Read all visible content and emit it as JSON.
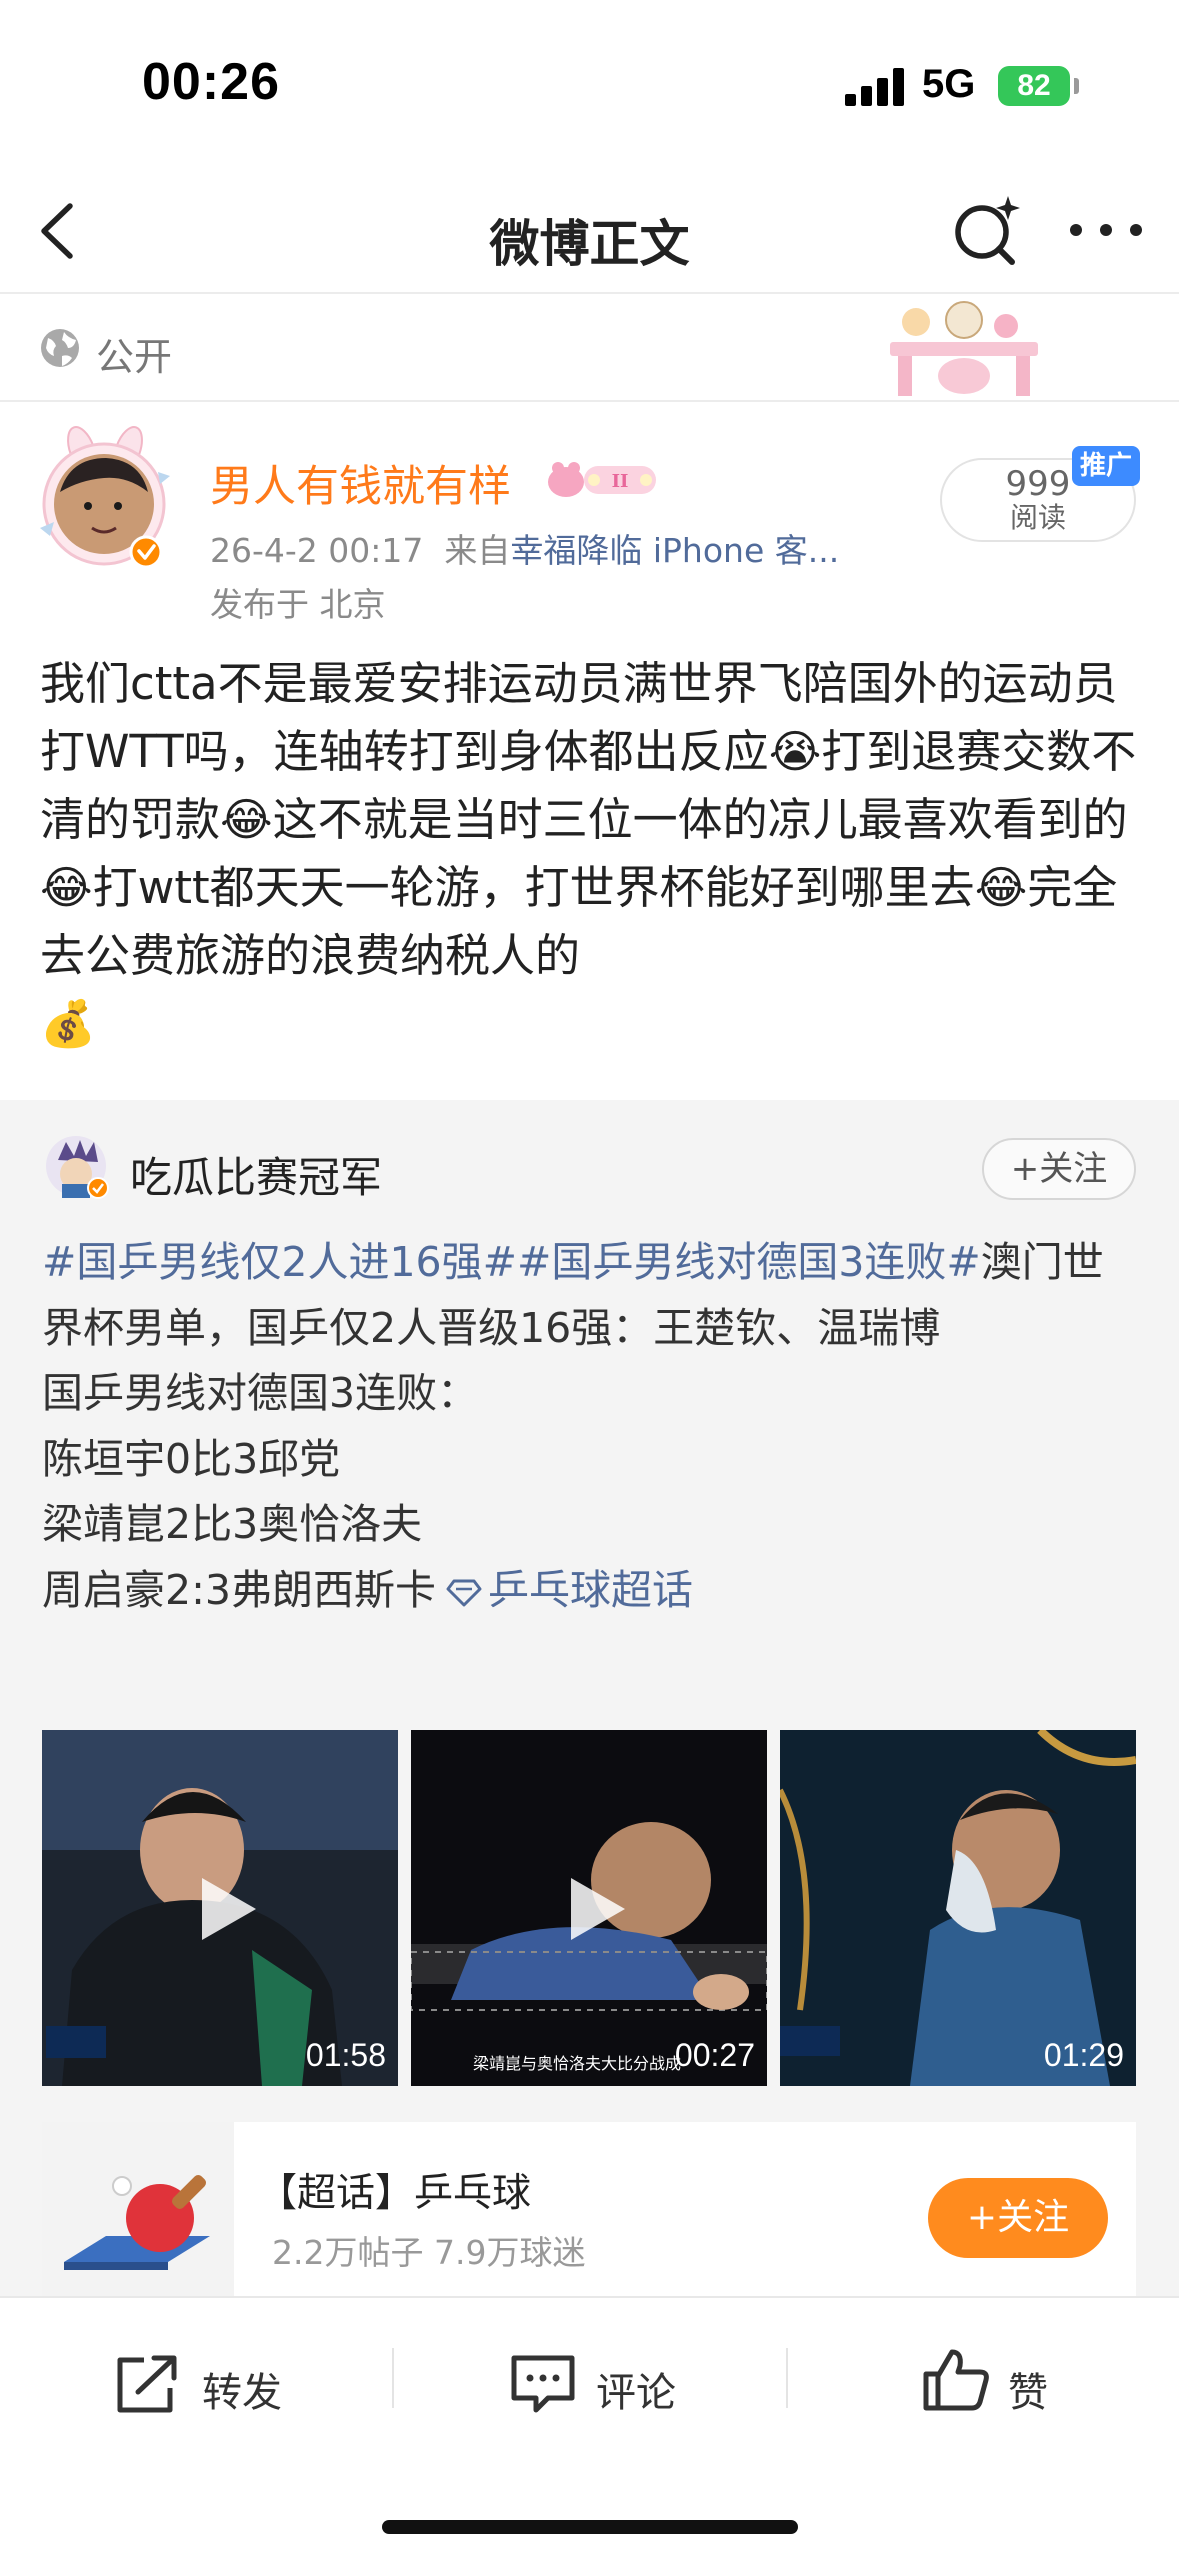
{
  "status_bar": {
    "time": "00:26",
    "network": "5G",
    "battery": "82"
  },
  "nav": {
    "title": "微博正文"
  },
  "visibility": {
    "label": "公开"
  },
  "post": {
    "author": "男人有钱就有样",
    "meta_time": "26-4-2 00:17",
    "meta_from": "来自",
    "meta_source": "幸福降临 iPhone 客...",
    "location": "发布于 北京",
    "read_count": "999",
    "read_label": "阅读",
    "promo_tag": "推广",
    "body_parts": {
      "p1": "我们ctta不是最爱安排运动员满世界飞陪国外的运动员打WTT吗，连轴转打到身体都出反应",
      "e1": "😭",
      "p2": "打到退赛交数不清的罚款",
      "e2": "😂",
      "p3": "这不就是当时三位一体的凉儿最喜欢看到的",
      "e3": "😂",
      "p4": "打wtt都天天一轮游，打世界杯能好到哪里去",
      "e4": "😂",
      "p5": "完全去公费旅游的浪费纳税人的",
      "e5": "💰"
    }
  },
  "repost": {
    "author": "吃瓜比赛冠军",
    "follow_label": "+关注",
    "topic1": "#国乒男线仅2人进16强#",
    "topic2": "#国乒男线对德国3连败#",
    "line1_rest": "澳门世界杯男单，国乒仅2人晋级16强：王楚钦、温瑞博",
    "line2": "国乒男线对德国3连败：",
    "line3": "陈垣宇0比3邱党",
    "line4": "梁靖崑2比3奥恰洛夫",
    "line5": "周启豪2:3弗朗西斯卡",
    "supertopic_link": "乒乓球超话",
    "videos": [
      {
        "duration": "01:58"
      },
      {
        "duration": "00:27",
        "caption": "梁靖崑与奥恰洛夫大比分战成"
      },
      {
        "duration": "01:29"
      }
    ],
    "super_card": {
      "title": "【超话】乒乓球",
      "stats": "2.2万帖子 7.9万球迷",
      "follow_label": "+关注"
    }
  },
  "actions": {
    "repost": "转发",
    "comment": "评论",
    "like": "赞"
  },
  "colors": {
    "accent_orange": "#ff8b1e",
    "link_blue": "#516b9a",
    "author_orange": "#ff7a1a",
    "battery_green": "#34c759"
  }
}
